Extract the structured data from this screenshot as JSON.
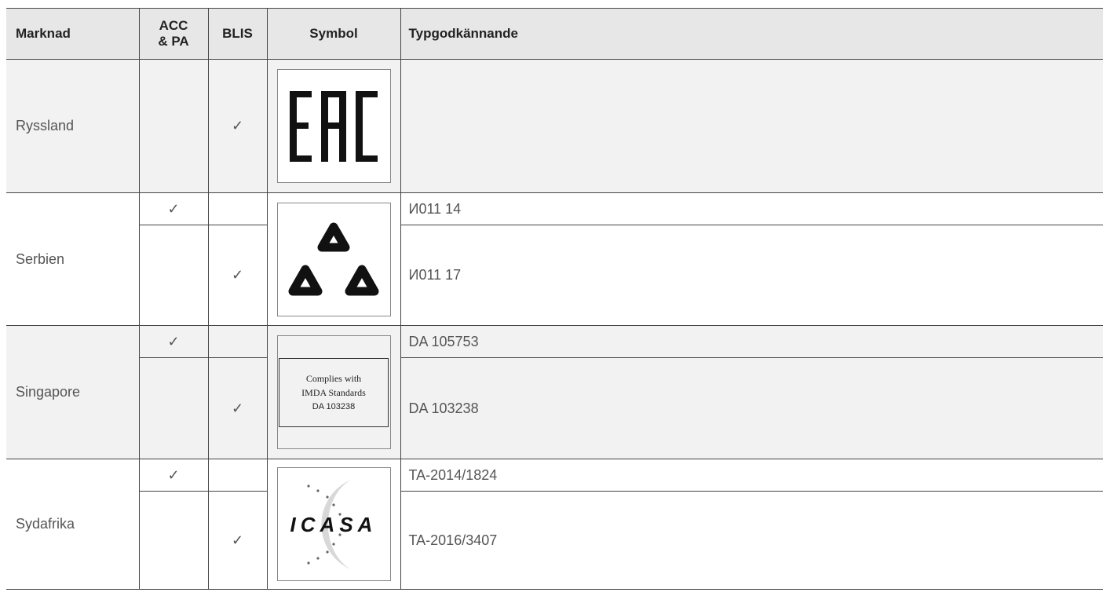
{
  "headers": {
    "market": "Marknad",
    "acc_pa": "ACC & PA",
    "blis": "BLIS",
    "symbol": "Symbol",
    "type_approval": "Typgodkännande"
  },
  "check_mark": "✓",
  "rows": [
    {
      "market": "Ryssland",
      "symbol_icon": "eac-mark-icon",
      "entries": [
        {
          "acc_pa": "",
          "blis": "✓",
          "approval": ""
        }
      ]
    },
    {
      "market": "Serbien",
      "symbol_icon": "serbian-triangle-mark-icon",
      "entries": [
        {
          "acc_pa": "✓",
          "blis": "",
          "approval": "И011 14"
        },
        {
          "acc_pa": "",
          "blis": "✓",
          "approval": "И011 17"
        }
      ]
    },
    {
      "market": "Singapore",
      "symbol_icon": "imda-label-icon",
      "symbol_text": [
        "Complies with",
        "IMDA Standards",
        "DA 103238"
      ],
      "entries": [
        {
          "acc_pa": "✓",
          "blis": "",
          "approval": "DA 105753"
        },
        {
          "acc_pa": "",
          "blis": "✓",
          "approval": "DA 103238"
        }
      ]
    },
    {
      "market": "Sydafrika",
      "symbol_icon": "icasa-logo-icon",
      "symbol_text": [
        "ICASA"
      ],
      "entries": [
        {
          "acc_pa": "✓",
          "blis": "",
          "approval": "TA-2014/1824"
        },
        {
          "acc_pa": "",
          "blis": "✓",
          "approval": "TA-2016/3407"
        }
      ]
    }
  ]
}
